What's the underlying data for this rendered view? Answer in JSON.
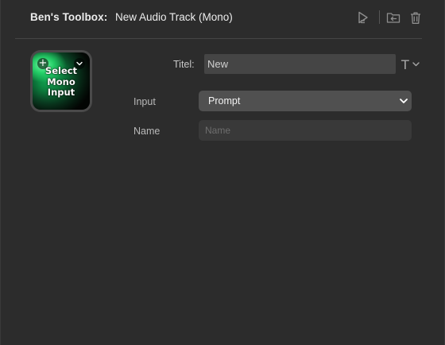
{
  "header": {
    "app_title": "Ben's Toolbox:",
    "doc_title": "New Audio Track (Mono)",
    "icons": [
      "play-action-icon",
      "folder-back-icon",
      "trash-icon"
    ]
  },
  "key": {
    "label": "Select\nMono\nInput",
    "plus_glyph": "+",
    "accent_color": "#16b65a"
  },
  "form": {
    "titel_label": "Titel:",
    "titel_value": "New",
    "title_style_glyph": "T",
    "input_label": "Input",
    "input_selected": "Prompt",
    "name_label": "Name",
    "name_placeholder": "Name"
  }
}
